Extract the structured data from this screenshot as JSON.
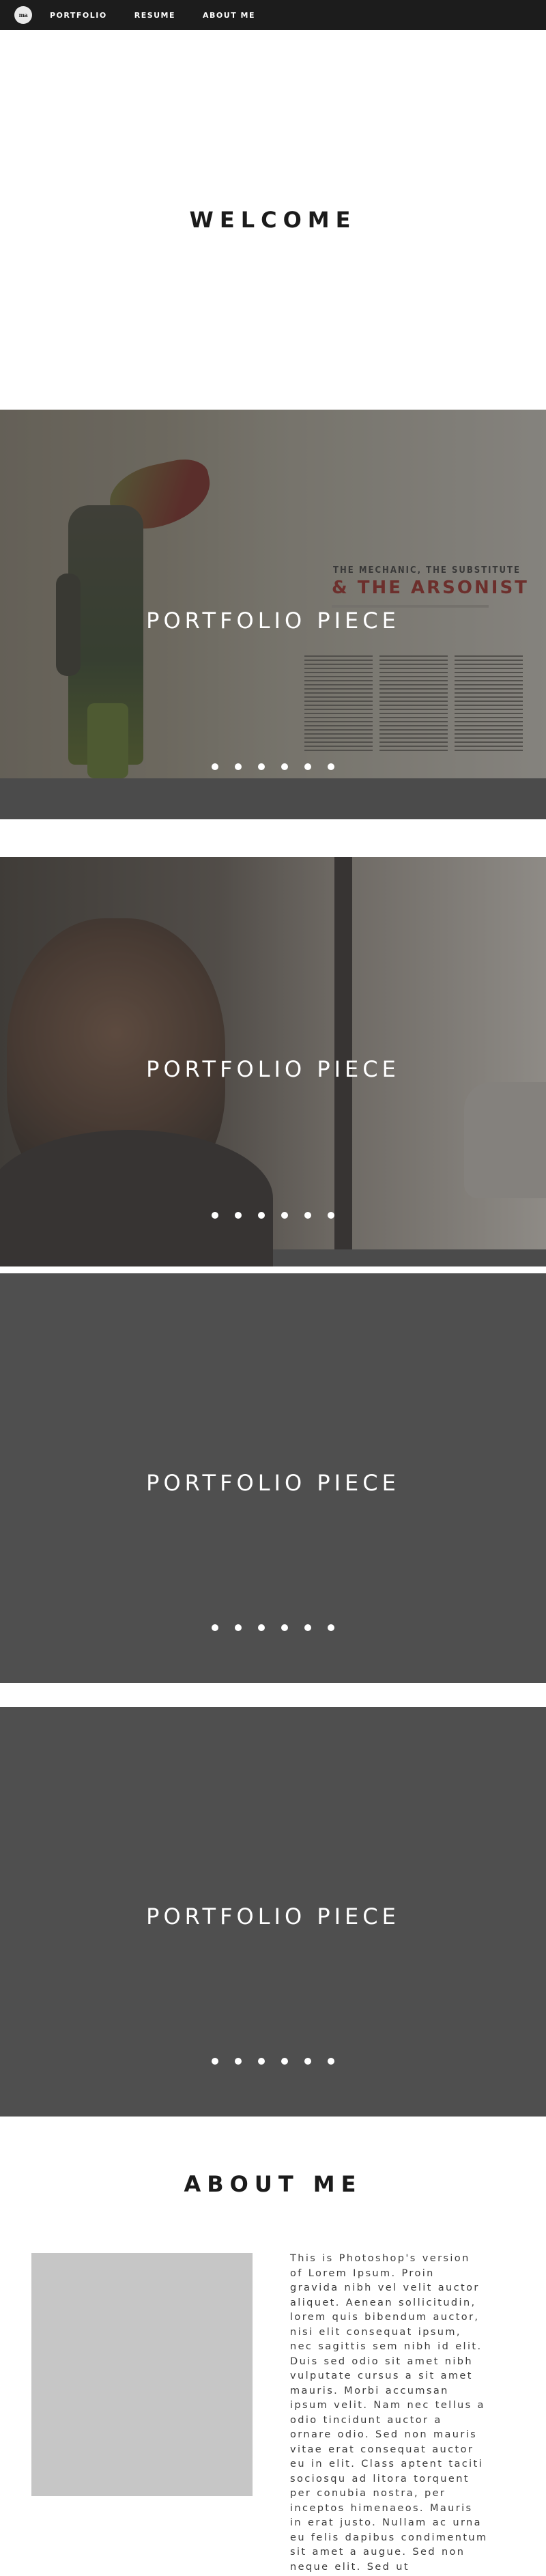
{
  "nav": {
    "logo_text": "ma",
    "links": [
      {
        "label": "PORTFOLIO"
      },
      {
        "label": "RESUME"
      },
      {
        "label": "ABOUT ME"
      }
    ]
  },
  "welcome": {
    "title": "WELCOME"
  },
  "portfolio": {
    "pieces": [
      {
        "title": "PORTFOLIO PIECE",
        "magazine_title": "THE MECHANIC, THE SUBSTITUTE",
        "magazine_headline": "& THE ARSONIST",
        "dots": 6
      },
      {
        "title": "PORTFOLIO PIECE",
        "dots": 6
      },
      {
        "title": "PORTFOLIO PIECE",
        "dots": 6
      },
      {
        "title": "PORTFOLIO PIECE",
        "dots": 6
      }
    ]
  },
  "about": {
    "title": "ABOUT ME",
    "text": "This is Photoshop's version of Lorem Ipsum. Proin gravida nibh vel velit auctor aliquet. Aenean sollicitudin, lorem quis bibendum auctor, nisi elit consequat ipsum, nec sagittis sem nibh id elit. Duis sed odio sit amet nibh vulputate cursus a sit amet mauris. Morbi accumsan ipsum velit. Nam nec tellus a odio tincidunt auctor a ornare odio. Sed non mauris vitae erat consequat auctor eu in elit. Class aptent taciti sociosqu ad litora torquent per conubia nostra, per inceptos himenaeos. Mauris in erat justo. Nullam ac urna eu felis dapibus condimentum sit amet a augue. Sed non neque elit. Sed ut"
  },
  "colors": {
    "nav_bg": "#1c1c1c",
    "section_bg": "#4f4f4f",
    "photo_placeholder": "#c6c6c6",
    "accent_red": "#8a1d17"
  }
}
